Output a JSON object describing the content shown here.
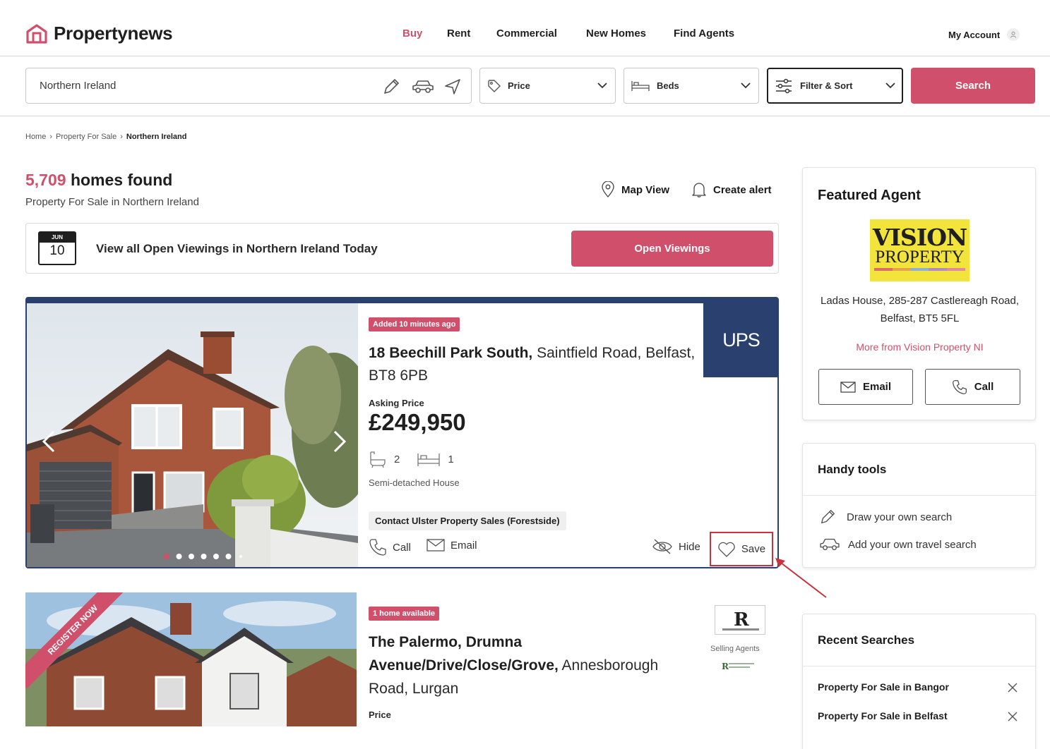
{
  "header": {
    "logo_text": "Propertynews",
    "nav": [
      {
        "label": "Buy",
        "active": true
      },
      {
        "label": "Rent"
      },
      {
        "label": "Commercial"
      },
      {
        "label": "New Homes"
      },
      {
        "label": "Find Agents"
      }
    ],
    "account_label": "My Account"
  },
  "search": {
    "location_value": "Northern Ireland",
    "price_label": "Price",
    "beds_label": "Beds",
    "filter_label": "Filter & Sort",
    "search_button": "Search"
  },
  "breadcrumb": {
    "home": "Home",
    "for_sale": "Property For Sale",
    "current": "Northern Ireland"
  },
  "results": {
    "count": "5,709",
    "title_suffix": " homes found",
    "subtitle": "Property For Sale in Northern Ireland",
    "map_view": "Map View",
    "create_alert": "Create alert"
  },
  "open_viewings": {
    "cal_month": "JUN",
    "cal_day": "10",
    "text": "View all Open Viewings in Northern Ireland Today",
    "button": "Open Viewings"
  },
  "listings": [
    {
      "badge": "Added 10 minutes ago",
      "address_bold": "18 Beechill Park South,",
      "address_rest": " Saintfield Road, Belfast, BT8 6PB",
      "price_label": "Asking Price",
      "price": "£249,950",
      "beds": "2",
      "baths": "1",
      "type": "Semi-detached House",
      "contact": "Contact Ulster Property Sales (Forestside)",
      "call": "Call",
      "email": "Email",
      "hide": "Hide",
      "save": "Save",
      "agent_logo": "UPS",
      "photo_dots_total": 7,
      "photo_dots_active": 1
    },
    {
      "badge": "1 home available",
      "address_bold": "The Palermo, Drumna Avenue/Drive/Close/Grove,",
      "address_rest": " Annesborough Road, Lurgan",
      "price_label": "Price",
      "ribbon": "REGISTER NOW",
      "selling_agents": "Selling Agents"
    }
  ],
  "sidebar": {
    "featured": {
      "title": "Featured Agent",
      "logo_line1": "VISION",
      "logo_line2": "PROPERTY",
      "address": "Ladas House, 285-287 Castlereagh Road, Belfast, BT5 5FL",
      "more_link": "More from Vision Property NI",
      "email": "Email",
      "call": "Call"
    },
    "tools": {
      "title": "Handy tools",
      "draw": "Draw your own search",
      "travel": "Add your own travel search"
    },
    "recent": {
      "title": "Recent Searches",
      "items": [
        "Property For Sale in Bangor",
        "Property For Sale in Belfast"
      ]
    }
  },
  "colors": {
    "brand_pink": "#d0506b",
    "navy": "#2a4170",
    "annotation_red": "#c8313d",
    "vision_yellow": "#f2e43a"
  }
}
